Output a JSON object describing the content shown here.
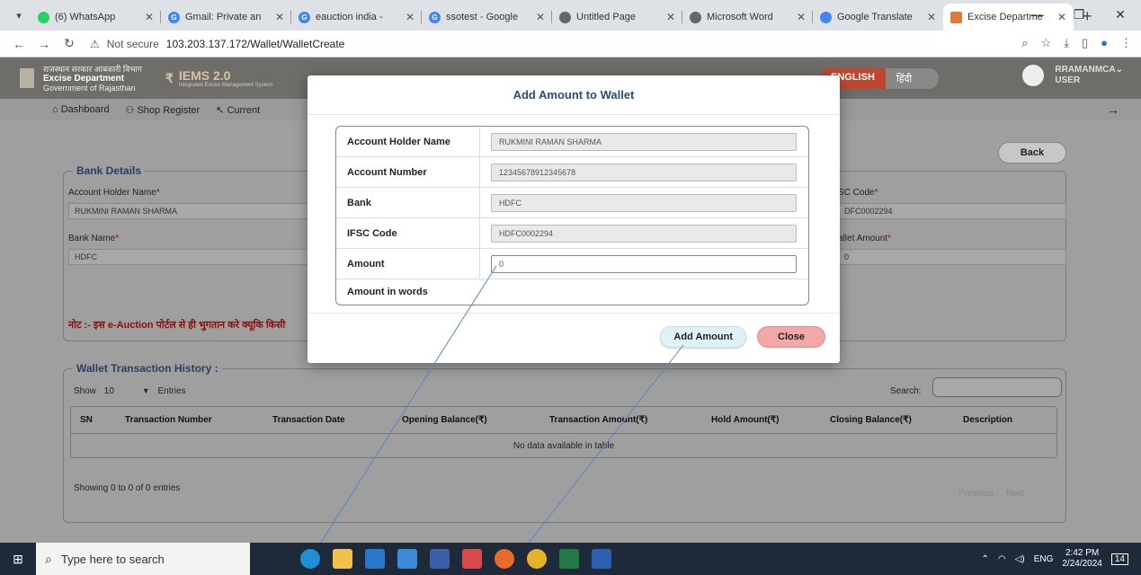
{
  "tabs": [
    {
      "title": "(6) WhatsApp",
      "color": "#25d366"
    },
    {
      "title": "Gmail: Private an",
      "color": "#4285f4"
    },
    {
      "title": "eauction india -",
      "color": "#4285f4"
    },
    {
      "title": "ssotest - Google",
      "color": "#4285f4"
    },
    {
      "title": "Untitled Page",
      "color": "#666666"
    },
    {
      "title": "Microsoft Word",
      "color": "#666666"
    },
    {
      "title": "Google Translate",
      "color": "#4285f4"
    },
    {
      "title": "Excise Departme",
      "color": "#e07b39"
    }
  ],
  "address": {
    "security": "Not secure",
    "url": "103.203.137.172/Wallet/WalletCreate"
  },
  "header": {
    "dept_line1": "राजस्थान सरकार आबकारी विभाग",
    "dept_name": "Excise Department",
    "dept_line3": "Government of Rajasthan",
    "app_name": "IEMS 2.0",
    "app_sub": "Integrated Excise Management System",
    "lang_en": "ENGLISH",
    "lang_hi": "हिंदी",
    "user_line1": "RRAMANMCA",
    "user_line2": "USER"
  },
  "menu": {
    "dashboard": "Dashboard",
    "shop_register": "Shop Register",
    "current": "Current"
  },
  "back_label": "Back",
  "bank": {
    "legend": "Bank Details",
    "holder_label": "Account Holder Name",
    "holder_value": "RUKMINI RAMAN SHARMA",
    "bank_label": "Bank Name",
    "bank_value": "HDFC",
    "ifsc_label": "SC Code",
    "ifsc_value": "DFC0002294",
    "wallet_label": "allet Amount",
    "wallet_value": "0",
    "note": "नोट :- इस e-Auction पोर्टल से ही भुगतान करे क्यूकि किसी"
  },
  "history": {
    "legend": "Wallet Transaction History :",
    "show": "Show",
    "entries_value": "10",
    "entries": "Entries",
    "search_label": "Search:",
    "columns": [
      "SN",
      "Transaction Number",
      "Transaction Date",
      "Opening Balance(₹)",
      "Transaction Amount(₹)",
      "Hold Amount(₹)",
      "Closing Balance(₹)",
      "Description"
    ],
    "empty": "No data available in table",
    "info": "Showing 0 to 0 of 0 entries",
    "previous": "Previous",
    "next": "Next"
  },
  "modal": {
    "title": "Add Amount to Wallet",
    "rows": [
      {
        "label": "Account Holder Name",
        "value": "RUKMINI RAMAN SHARMA"
      },
      {
        "label": "Account Number",
        "value": "12345678912345678"
      },
      {
        "label": "Bank",
        "value": "HDFC"
      },
      {
        "label": "IFSC Code",
        "value": "HDFC0002294"
      },
      {
        "label": "Amount",
        "value": "0"
      },
      {
        "label": "Amount in words",
        "value": ""
      }
    ],
    "add_button": "Add Amount",
    "close_button": "Close"
  },
  "taskbar": {
    "search_placeholder": "Type here to search",
    "lang": "ENG",
    "time": "2:42 PM",
    "date": "2/24/2024",
    "notif": "14"
  }
}
